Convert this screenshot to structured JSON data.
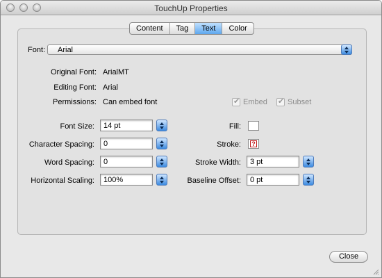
{
  "window": {
    "title": "TouchUp Properties"
  },
  "tabs": [
    {
      "label": "Content"
    },
    {
      "label": "Tag"
    },
    {
      "label": "Text",
      "active": true
    },
    {
      "label": "Color"
    }
  ],
  "font": {
    "label": "Font:",
    "value": "Arial"
  },
  "info": {
    "original_font_label": "Original Font:",
    "original_font_value": "ArialMT",
    "editing_font_label": "Editing Font:",
    "editing_font_value": "Arial",
    "permissions_label": "Permissions:",
    "permissions_value": "Can embed font",
    "embed_label": "Embed",
    "embed_checked": true,
    "subset_label": "Subset",
    "subset_checked": true
  },
  "left_fields": {
    "font_size_label": "Font Size:",
    "font_size_value": "14 pt",
    "char_spacing_label": "Character Spacing:",
    "char_spacing_value": "0",
    "word_spacing_label": "Word Spacing:",
    "word_spacing_value": "0",
    "horiz_scaling_label": "Horizontal Scaling:",
    "horiz_scaling_value": "100%"
  },
  "right_fields": {
    "fill_label": "Fill:",
    "fill_color": "#ffffff",
    "stroke_label": "Stroke:",
    "stroke_width_label": "Stroke Width:",
    "stroke_width_value": "3 pt",
    "baseline_label": "Baseline Offset:",
    "baseline_value": "0 pt"
  },
  "buttons": {
    "close_label": "Close"
  },
  "colors": {
    "accent": "#5ea7ee",
    "stroke_indicator": "#c01818"
  }
}
